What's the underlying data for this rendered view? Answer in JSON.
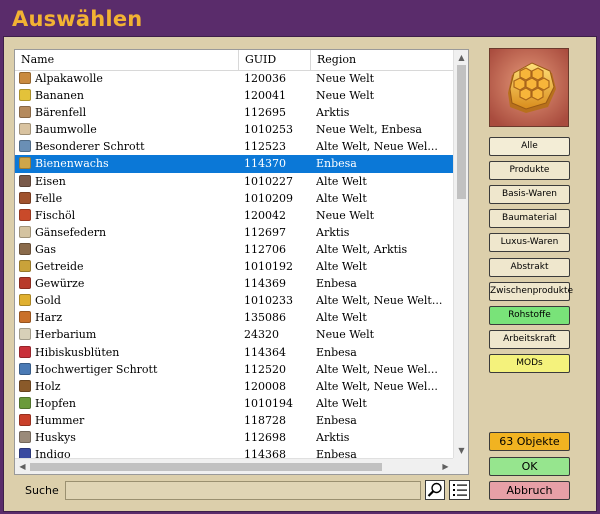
{
  "window": {
    "title": "Auswählen"
  },
  "list": {
    "columns": {
      "name": "Name",
      "guid": "GUID",
      "region": "Region"
    },
    "selected_index": 5,
    "rows": [
      {
        "name": "Alpakawolle",
        "guid": "120036",
        "region": "Neue Welt",
        "color": "#c98a3f"
      },
      {
        "name": "Bananen",
        "guid": "120041",
        "region": "Neue Welt",
        "color": "#e3c23a"
      },
      {
        "name": "Bärenfell",
        "guid": "112695",
        "region": "Arktis",
        "color": "#b58a5c"
      },
      {
        "name": "Baumwolle",
        "guid": "1010253",
        "region": "Neue Welt, Enbesa",
        "color": "#d9c3a0"
      },
      {
        "name": "Besonderer Schrott",
        "guid": "112523",
        "region": "Alte Welt, Neue Wel...",
        "color": "#6a8fb5"
      },
      {
        "name": "Bienenwachs",
        "guid": "114370",
        "region": "Enbesa",
        "color": "#cfa64a"
      },
      {
        "name": "Eisen",
        "guid": "1010227",
        "region": "Alte Welt",
        "color": "#7a5a4a"
      },
      {
        "name": "Felle",
        "guid": "1010209",
        "region": "Alte Welt",
        "color": "#a0522d"
      },
      {
        "name": "Fischöl",
        "guid": "120042",
        "region": "Neue Welt",
        "color": "#c94a2a"
      },
      {
        "name": "Gänsefedern",
        "guid": "112697",
        "region": "Arktis",
        "color": "#d4c3a0"
      },
      {
        "name": "Gas",
        "guid": "112706",
        "region": "Alte Welt, Arktis",
        "color": "#8a6a4a"
      },
      {
        "name": "Getreide",
        "guid": "1010192",
        "region": "Alte Welt",
        "color": "#c9a23a"
      },
      {
        "name": "Gewürze",
        "guid": "114369",
        "region": "Enbesa",
        "color": "#b83a2a"
      },
      {
        "name": "Gold",
        "guid": "1010233",
        "region": "Alte Welt, Neue Welt...",
        "color": "#e0b030"
      },
      {
        "name": "Harz",
        "guid": "135086",
        "region": "Alte Welt",
        "color": "#c9702a"
      },
      {
        "name": "Herbarium",
        "guid": "24320",
        "region": "Neue Welt",
        "color": "#d8d0b8"
      },
      {
        "name": "Hibiskusblüten",
        "guid": "114364",
        "region": "Enbesa",
        "color": "#c9303a"
      },
      {
        "name": "Hochwertiger Schrott",
        "guid": "112520",
        "region": "Alte Welt, Neue Wel...",
        "color": "#4a7ab5"
      },
      {
        "name": "Holz",
        "guid": "120008",
        "region": "Alte Welt, Neue Wel...",
        "color": "#8a5a2a"
      },
      {
        "name": "Hopfen",
        "guid": "1010194",
        "region": "Alte Welt",
        "color": "#6a9a3a"
      },
      {
        "name": "Hummer",
        "guid": "118728",
        "region": "Enbesa",
        "color": "#c9402a"
      },
      {
        "name": "Huskys",
        "guid": "112698",
        "region": "Arktis",
        "color": "#9a8a7a"
      },
      {
        "name": "Indigo",
        "guid": "114368",
        "region": "Enbesa",
        "color": "#3a4aa0"
      }
    ]
  },
  "sidebar": {
    "filters": [
      {
        "label": "Alle",
        "style": "alle"
      },
      {
        "label": "Produkte",
        "style": "plain"
      },
      {
        "label": "Basis-Waren",
        "style": "plain"
      },
      {
        "label": "Baumaterial",
        "style": "plain"
      },
      {
        "label": "Luxus-Waren",
        "style": "plain"
      },
      {
        "label": "Abstrakt",
        "style": "plain"
      },
      {
        "label": "Zwischenprodukte",
        "style": "plain"
      },
      {
        "label": "Rohstoffe",
        "style": "green"
      },
      {
        "label": "Arbeitskraft",
        "style": "plain"
      },
      {
        "label": "MODs",
        "style": "yellow"
      }
    ],
    "count_label": "63 Objekte",
    "ok_label": "OK",
    "cancel_label": "Abbruch"
  },
  "search": {
    "label": "Suche",
    "value": ""
  }
}
